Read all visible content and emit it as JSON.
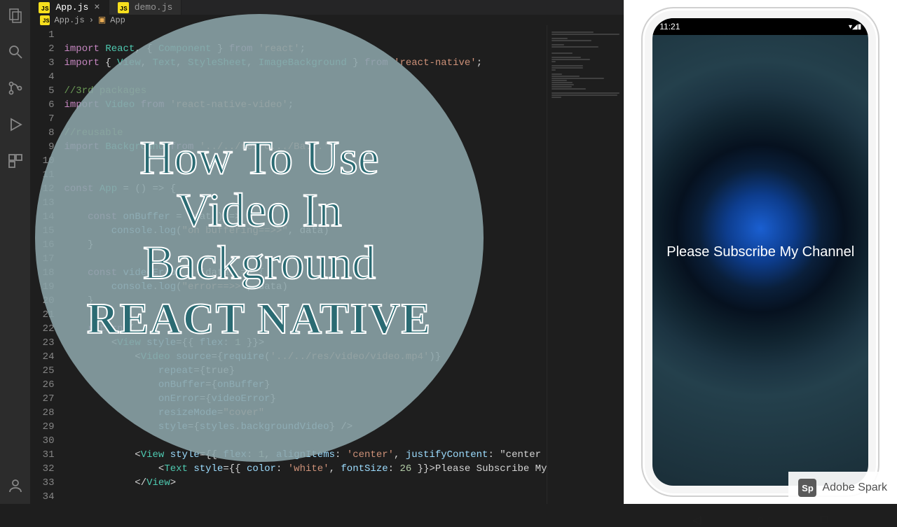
{
  "tabs": [
    {
      "label": "App.js",
      "active": true
    },
    {
      "label": "demo.js",
      "active": false
    }
  ],
  "breadcrumb": {
    "file": "App.js",
    "symbol": "App"
  },
  "gutter_start": 1,
  "gutter_end": 34,
  "code_lines": [
    "",
    "import React, { Component } from 'react';",
    "import { View, Text, StyleSheet, ImageBackground } from 'react-native';",
    "",
    "//3rd packages",
    "import Video from 'react-native-video';",
    "",
    "//reusable",
    "import Background from '../../res/c.../Ba...';",
    "",
    "",
    "const App = () => {",
    "",
    "    const onBuffer = (data) => {",
    "        console.log(\"on buffering==>>\", data)",
    "    }",
    "",
    "    const videoError = (data) => {",
    "        console.log(\"error==>>\", data)",
    "    }",
    "",
    "    return (",
    "        <View style={{ flex: 1 }}>",
    "            <Video source={require('../../res/video/video.mp4')}",
    "                repeat={true}",
    "                onBuffer={onBuffer}",
    "                onError={videoError}",
    "                resizeMode=\"cover\"",
    "                style={styles.backgroundVideo} />",
    "",
    "            <View style={{ flex: 1, alignItems: 'center', justifyContent: \"center",
    "                <Text style={{ color: 'white', fontSize: 26 }}>Please Subscribe My",
    "            </View>",
    ""
  ],
  "overlay": {
    "line_a": "How To Use",
    "line_b": "Video In",
    "line_c": "Background",
    "line_d": "REACT NATIVE"
  },
  "phone": {
    "time": "11:21",
    "status_icons": "▾◢▮",
    "center_text": "Please Subscribe My Channel"
  },
  "watermark": {
    "badge": "Sp",
    "label": "Adobe Spark"
  }
}
